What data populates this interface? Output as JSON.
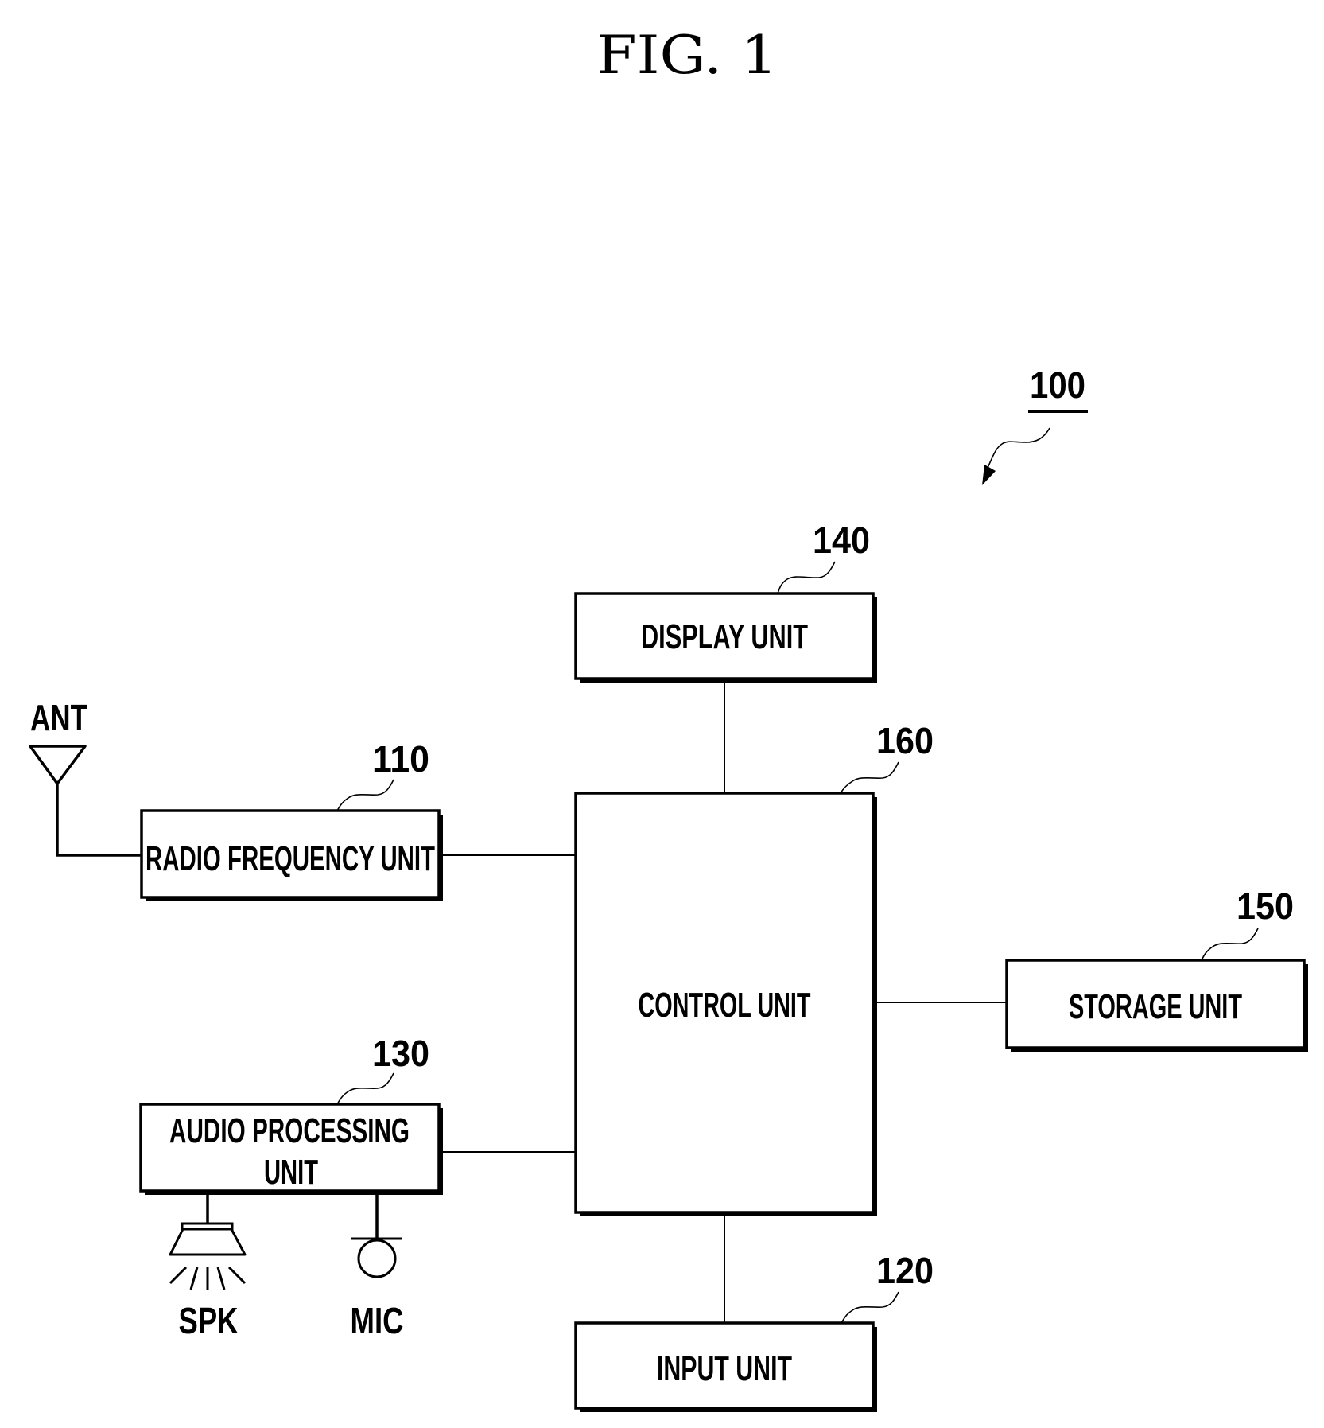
{
  "figure": {
    "title": "FIG. 1",
    "device_ref": "100"
  },
  "blocks": {
    "display": {
      "label": "DISPLAY UNIT",
      "ref": "140"
    },
    "control": {
      "label": "CONTROL UNIT",
      "ref": "160"
    },
    "radio": {
      "label": "RADIO FREQUENCY UNIT",
      "ref": "110"
    },
    "audio": {
      "label_line1": "AUDIO PROCESSING",
      "label_line2": "UNIT",
      "ref": "130"
    },
    "storage": {
      "label": "STORAGE UNIT",
      "ref": "150"
    },
    "input": {
      "label": "INPUT UNIT",
      "ref": "120"
    }
  },
  "peripherals": {
    "antenna": "ANT",
    "speaker": "SPK",
    "microphone": "MIC"
  }
}
